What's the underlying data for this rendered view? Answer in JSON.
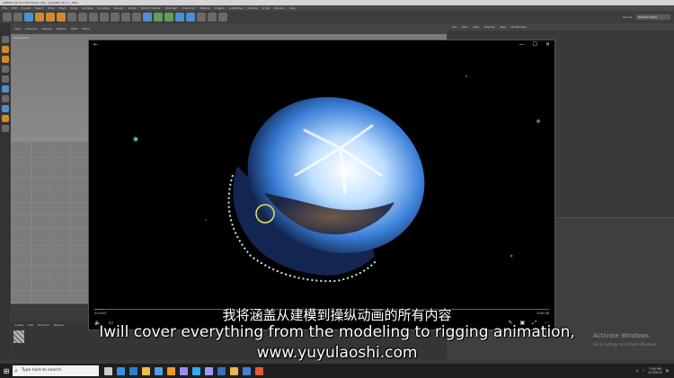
{
  "app": {
    "title": "CINEMA 4D R17.016 Studio (RC) - [jellyfish.c4d *] - Main",
    "menu": [
      "File",
      "Edit",
      "Create",
      "Select",
      "Tools",
      "Mesh",
      "Snap",
      "Animate",
      "Simulate",
      "Render",
      "Sculpt",
      "Motion Tracker",
      "MoGraph",
      "Character",
      "Pipeline",
      "Plugins",
      "X-Particles",
      "Octane",
      "Script",
      "Window",
      "Help"
    ],
    "viewport_menu": [
      "View",
      "Cameras",
      "Display",
      "Options",
      "Filter",
      "Panel"
    ],
    "viewport_label": "Perspective",
    "materials_menu": [
      "Create",
      "Edit",
      "Function",
      "Texture"
    ],
    "layout_label": "Layout:",
    "layout_value": "Startup (User)",
    "right_menu": [
      "File",
      "Edit",
      "View",
      "Objects",
      "Tags",
      "Bookmarks"
    ],
    "watermark_title": "Activate Windows",
    "watermark_sub": "Go to Settings to activate Windows."
  },
  "player": {
    "back_icon": "←",
    "minimize": "—",
    "maximize": "☐",
    "close": "✕",
    "time_elapsed": "0:00:00",
    "time_total": "0:00:08",
    "progress": 0.02,
    "controls_left": [
      "volume-icon",
      "aspect-icon"
    ],
    "controls_right": [
      "edit-icon",
      "cast-icon",
      "fullscreen-icon",
      "more-icon"
    ]
  },
  "subtitles": {
    "chinese": "我将涵盖从建模到操纵动画的所有内容",
    "english": "Iwill cover everything from the modeling to rigging animation,",
    "url": "www.yuyulaoshi.com"
  },
  "taskbar": {
    "search_placeholder": "Type here to search",
    "time": "7:36 PM",
    "date": "1/7/2019",
    "apps": [
      {
        "name": "task-view-icon",
        "color": "#cccccc"
      },
      {
        "name": "edge-icon",
        "color": "#3a8ee6"
      },
      {
        "name": "store-icon",
        "color": "#2d7dd2"
      },
      {
        "name": "explorer-icon",
        "color": "#e8c04a"
      },
      {
        "name": "mail-icon",
        "color": "#4aa0e6"
      },
      {
        "name": "illustrator-icon",
        "color": "#f29a1f"
      },
      {
        "name": "premiere-icon",
        "color": "#9a8cf2"
      },
      {
        "name": "photoshop-icon",
        "color": "#31a8ff"
      },
      {
        "name": "aftereffects-icon",
        "color": "#9999ff"
      },
      {
        "name": "c4d-icon",
        "color": "#3b6fb5"
      },
      {
        "name": "chrome-icon",
        "color": "#e6b84a"
      },
      {
        "name": "photos-icon",
        "color": "#4a7fd6"
      },
      {
        "name": "media-icon",
        "color": "#e35a3a"
      }
    ]
  }
}
